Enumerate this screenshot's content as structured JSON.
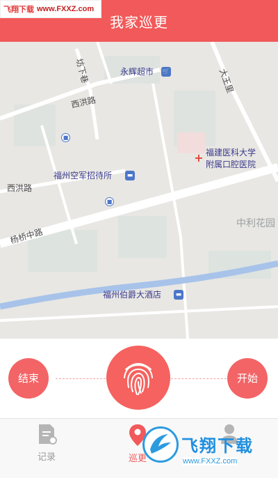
{
  "watermark_top": {
    "prefix": "飞翔下载",
    "url": "www.FXXZ.com"
  },
  "header": {
    "title": "我家巡更"
  },
  "map": {
    "labels": {
      "fangxiaxiang": "坊下巷",
      "yonghui": "永辉超市",
      "dawangli": "大王里",
      "xihonglu1": "西洪路",
      "hospital_line1": "福建医科大学",
      "hospital_line2": "附属口腔医院",
      "kongjun": "福州空军招待所",
      "xihonglu2": "西洪路",
      "yangqiao": "杨桥中路",
      "zhongli": "中利花园",
      "bojue": "福州伯爵大酒店"
    }
  },
  "controls": {
    "end_label": "结束",
    "start_label": "开始"
  },
  "tabs": [
    {
      "label": "记录",
      "icon": "record-icon"
    },
    {
      "label": "巡更",
      "icon": "location-pin-icon"
    },
    {
      "label": "",
      "icon": "user-icon"
    }
  ],
  "watermark_bottom": {
    "brand": "飞翔下载",
    "url": "www.FXXZ.com"
  },
  "colors": {
    "accent": "#f2595a",
    "map_bg": "#e9e8e4",
    "river": "#9ab9e6"
  }
}
